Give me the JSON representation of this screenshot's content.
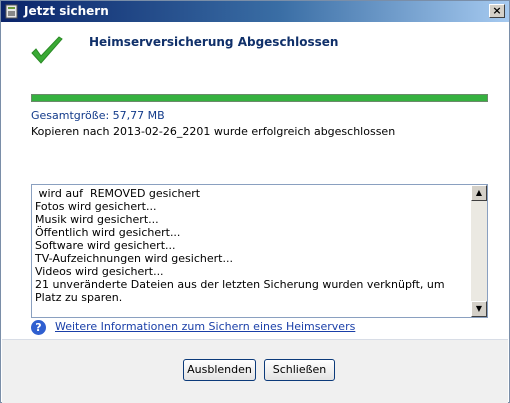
{
  "window": {
    "title": "Jetzt sichern",
    "close_label": "×"
  },
  "header": {
    "title": "Heimserversicherung Abgeschlossen"
  },
  "progress": {
    "percent": 100
  },
  "summary": {
    "size": "Gesamtgröße: 57,77 MB",
    "status": "Kopieren nach 2013-02-26_2201 wurde erfolgreich abgeschlossen"
  },
  "log": {
    "lines": [
      " wird auf  REMOVED gesichert",
      "Fotos wird gesichert...",
      "Musik wird gesichert...",
      "Öffentlich wird gesichert...",
      "Software wird gesichert...",
      "TV-Aufzeichnungen wird gesichert...",
      "Videos wird gesichert...",
      "21 unveränderte Dateien aus der letzten Sicherung wurden verknüpft, um Platz zu sparen."
    ]
  },
  "help": {
    "link_text": "Weitere Informationen zum Sichern eines Heimservers"
  },
  "buttons": {
    "hide_label": "Ausblenden",
    "close_label": "Schließen"
  },
  "colors": {
    "accent": "#35b13f",
    "link": "#1a3fa8"
  }
}
